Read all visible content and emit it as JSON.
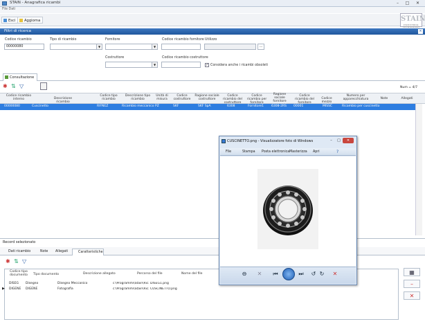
{
  "window": {
    "title": "STAIN - Anagrafica ricambi"
  },
  "menubar": {
    "label": "File  Dati"
  },
  "toolbar": {
    "buttons": [
      {
        "label": "Esci"
      },
      {
        "label": "Aggiorna"
      }
    ],
    "logo": "STAIN",
    "logo_sub": "INDUSTRIAL TECHNOLOGY"
  },
  "filter": {
    "section_title": "Filtri di ricerca",
    "codice_ricambio_label": "Codice ricambio",
    "codice_ricambio_value": "00000080",
    "tipo_ricambio_label": "Tipo di ricambio",
    "tipo_ricambio_value": "",
    "fornitore_label": "Fornitore",
    "fornitore_value": "",
    "codice_ricambio_fornitore_label": "Codice ricambio fornitore",
    "codice_ricambio_fornitore_value": "",
    "utilizzo_label": "Utilizzo",
    "utilizzo_value": "",
    "costruttore_label": "Costruttore",
    "costruttore_value": "",
    "codice_ricambio_costruttore_label": "Codice ricambio costruttore",
    "codice_ricambio_costruttore_value": "",
    "checkbox_label": "Considera anche i ricambi obsoleti"
  },
  "results": {
    "tab": "Consultazione",
    "count": "Num = 4/7",
    "columns": [
      "Codice ricambio interno",
      "Descrizione ricambio",
      "Codice tipo ricambio",
      "Descrizione tipo ricambio",
      "Unità di misura",
      "Codice costruttore",
      "Ragione sociale costruttore",
      "Codice ricambio del costruttore",
      "Codice ricambio per fornitore",
      "Ragione sociale fornitore",
      "Codice ricambio del fornitore",
      "Codice mezzo",
      "Numero per apparecchiatura",
      "Note",
      "Allegati"
    ],
    "row": [
      "00000080",
      "Cuscinetto",
      "RIFNEZ",
      "Ricambio meccanico",
      "PZ",
      "SKF",
      "SKF SpA",
      "6308",
      "Fornitore1",
      "6308-2RS",
      "00001",
      "MISSC",
      "Ricambio per cuscinetto",
      "",
      ""
    ]
  },
  "bottom": {
    "title": "Record selezionato",
    "tabs": [
      "Dati ricambio",
      "Note",
      "Allegati",
      "Caratteristiche"
    ],
    "columns": [
      "Codice tipo documento",
      "Tipo documento",
      "Descrizione allegato",
      "Percorso del file",
      "Nome del file"
    ],
    "rows": [
      [
        "DISEG",
        "Disegno",
        "Disegno Meccanico",
        "c:\\Programmi\\Stain\\Ricambi\\",
        "DISEG1.png"
      ],
      [
        "DIGENE",
        "DIGENE",
        "Fotografia",
        "c:\\Programmi\\Stain\\Ricambi\\",
        "CUSCINETTO.png"
      ]
    ]
  },
  "viewer": {
    "title": "CUSCINETTO.png - Visualizzatore foto di Windows",
    "menu": [
      "File",
      "Stampa",
      "Posta elettronica",
      "Masterizza",
      "Apri"
    ],
    "image_subject": "ball-bearing-photo"
  }
}
